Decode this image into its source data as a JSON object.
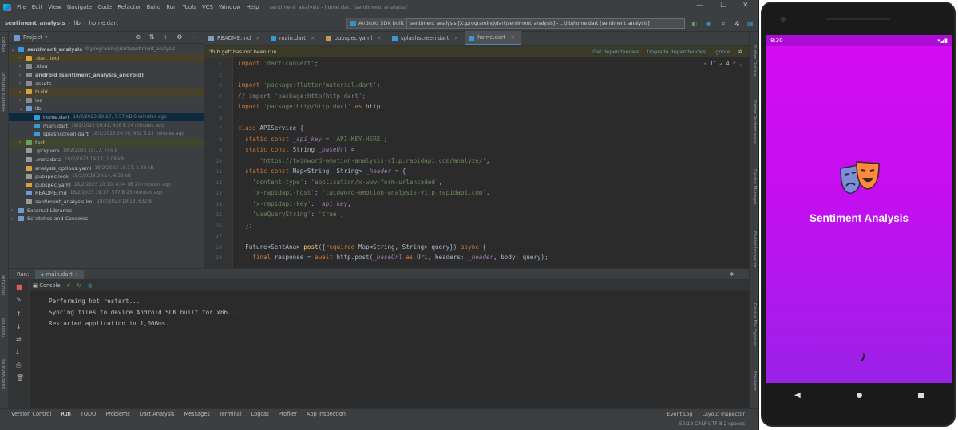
{
  "titlebar": {
    "menus": [
      "File",
      "Edit",
      "View",
      "Navigate",
      "Code",
      "Refactor",
      "Build",
      "Run",
      "Tools",
      "VCS",
      "Window",
      "Help"
    ],
    "project_title": "sentiment_analysis - home.dart [sentiment_analysis]"
  },
  "navbar": {
    "crumbs": [
      "sentiment_analysis",
      "lib",
      "home.dart"
    ],
    "run_config": "Android SDK built f",
    "tooltip": "sentiment_analysis [X:\\programing\\dart\\sentiment_analysis] - ...\\lib\\home.dart [sentiment_analysis]"
  },
  "side_labels": {
    "left": [
      "Project",
      "Resource Manager",
      "Structure",
      "Favorites",
      "Build Variants"
    ],
    "right": [
      "Flutter Outline",
      "Flutter Performance",
      "Device Manager",
      "Flutter Inspector",
      "Device File Explorer",
      "Emulator"
    ]
  },
  "project_panel": {
    "title": "Project",
    "root": {
      "name": "sentiment_analysis",
      "path": "X:\\programing\\dart\\sentiment_analysis"
    },
    "items": [
      {
        "name": ".dart_tool",
        "meta": ""
      },
      {
        "name": ".idea",
        "meta": ""
      },
      {
        "name": "android [sentiment_analysis_android]",
        "meta": ""
      },
      {
        "name": "assets",
        "meta": ""
      },
      {
        "name": "build",
        "meta": ""
      },
      {
        "name": "ios",
        "meta": ""
      },
      {
        "name": "lib",
        "meta": ""
      },
      {
        "name": "home.dart",
        "meta": "18/2/2023 20:27, 7.57 kB 6 minutes ago"
      },
      {
        "name": "main.dart",
        "meta": "18/2/2023 16:41, 426 B 24 minutes ago"
      },
      {
        "name": "splashscreen.dart",
        "meta": "18/2/2023 20:09, 962 B 22 minutes ago"
      },
      {
        "name": "test",
        "meta": ""
      },
      {
        "name": ".gitignore",
        "meta": "18/2/2023 19:17, 745 B"
      },
      {
        "name": ".metadata",
        "meta": "18/2/2023 19:17, 1.08 kB"
      },
      {
        "name": "analysis_options.yaml",
        "meta": "18/2/2023 19:17, 1.48 kB"
      },
      {
        "name": "pubspec.lock",
        "meta": "18/2/2023 20:14, 6.23 kB"
      },
      {
        "name": "pubspec.yaml",
        "meta": "18/2/2023 20:10, 4.04 kB 20 minutes ago"
      },
      {
        "name": "README.md",
        "meta": "18/2/2023 19:17, 577 B 25 minutes ago"
      },
      {
        "name": "sentiment_analysis.iml",
        "meta": "18/2/2023 19:18, 632 B"
      },
      {
        "name": "External Libraries",
        "meta": ""
      },
      {
        "name": "Scratches and Consoles",
        "meta": ""
      }
    ]
  },
  "tabs": [
    {
      "label": "README.md"
    },
    {
      "label": "main.dart"
    },
    {
      "label": "pubspec.yaml"
    },
    {
      "label": "splashscreen.dart"
    },
    {
      "label": "home.dart"
    }
  ],
  "notification": {
    "message": "'Pub get' has not been run",
    "links": [
      "Get dependencies",
      "Upgrade dependencies",
      "Ignore"
    ]
  },
  "inspections": {
    "warnings": "11",
    "ok": "4"
  },
  "editor": {
    "line_numbers": [
      "1",
      "2",
      "3",
      "4",
      "5",
      "6",
      "7",
      "8",
      "9",
      "10",
      "11",
      "12",
      "13",
      "14",
      "15",
      "16",
      "17",
      "18",
      "19"
    ]
  },
  "run_panel": {
    "label": "Run:",
    "config": "main.dart",
    "console_tab": "Console",
    "output": [
      "Performing hot restart...",
      "Syncing files to device Android SDK built for x86...",
      "Restarted application in 1,006ms."
    ]
  },
  "bottom_tabs": [
    "Version Control",
    "Run",
    "TODO",
    "Problems",
    "Dart Analysis",
    "Messages",
    "Terminal",
    "Logcat",
    "Profiler",
    "App Inspection"
  ],
  "bottom_right": [
    "Event Log",
    "Layout Inspector"
  ],
  "status": "50:19  CRLF  UTF-8  2 spaces",
  "phone": {
    "time": "8:30",
    "app_title": "Sentiment Analysis"
  }
}
